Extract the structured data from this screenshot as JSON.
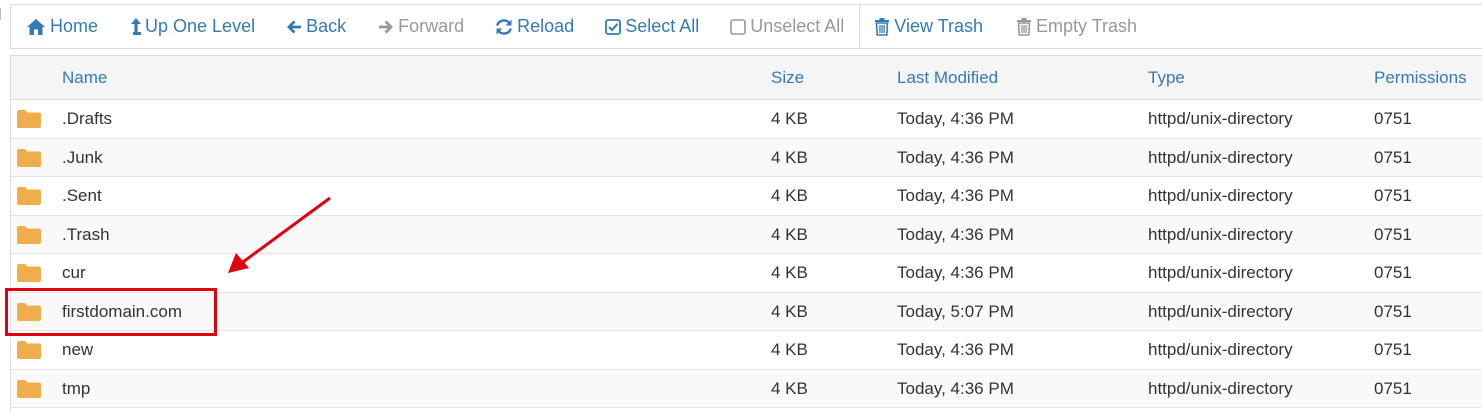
{
  "toolbar": {
    "home": "Home",
    "up_one_level": "Up One Level",
    "back": "Back",
    "forward": "Forward",
    "reload": "Reload",
    "select_all": "Select All",
    "unselect_all": "Unselect All",
    "view_trash": "View Trash",
    "empty_trash": "Empty Trash"
  },
  "table": {
    "headers": {
      "name": "Name",
      "size": "Size",
      "last_modified": "Last Modified",
      "type": "Type",
      "permissions": "Permissions"
    },
    "rows": [
      {
        "name": ".Drafts",
        "size": "4 KB",
        "modified": "Today, 4:36 PM",
        "type": "httpd/unix-directory",
        "perms": "0751"
      },
      {
        "name": ".Junk",
        "size": "4 KB",
        "modified": "Today, 4:36 PM",
        "type": "httpd/unix-directory",
        "perms": "0751"
      },
      {
        "name": ".Sent",
        "size": "4 KB",
        "modified": "Today, 4:36 PM",
        "type": "httpd/unix-directory",
        "perms": "0751"
      },
      {
        "name": ".Trash",
        "size": "4 KB",
        "modified": "Today, 4:36 PM",
        "type": "httpd/unix-directory",
        "perms": "0751"
      },
      {
        "name": "cur",
        "size": "4 KB",
        "modified": "Today, 4:36 PM",
        "type": "httpd/unix-directory",
        "perms": "0751"
      },
      {
        "name": "firstdomain.com",
        "size": "4 KB",
        "modified": "Today, 5:07 PM",
        "type": "httpd/unix-directory",
        "perms": "0751"
      },
      {
        "name": "new",
        "size": "4 KB",
        "modified": "Today, 4:36 PM",
        "type": "httpd/unix-directory",
        "perms": "0751"
      },
      {
        "name": "tmp",
        "size": "4 KB",
        "modified": "Today, 4:36 PM",
        "type": "httpd/unix-directory",
        "perms": "0751"
      }
    ]
  },
  "icons": {
    "folder": "folder-icon",
    "home": "home-icon",
    "up": "arrow-up-icon",
    "back": "arrow-left-icon",
    "forward": "arrow-right-icon",
    "reload": "reload-icon",
    "checkbox_checked": "checkbox-checked-icon",
    "checkbox_empty": "checkbox-empty-icon",
    "trash": "trash-icon"
  },
  "colors": {
    "link": "#337ab7",
    "disabled": "#999999",
    "text": "#333333",
    "folder": "#f0ad4e",
    "annotation": "#e0000f"
  }
}
